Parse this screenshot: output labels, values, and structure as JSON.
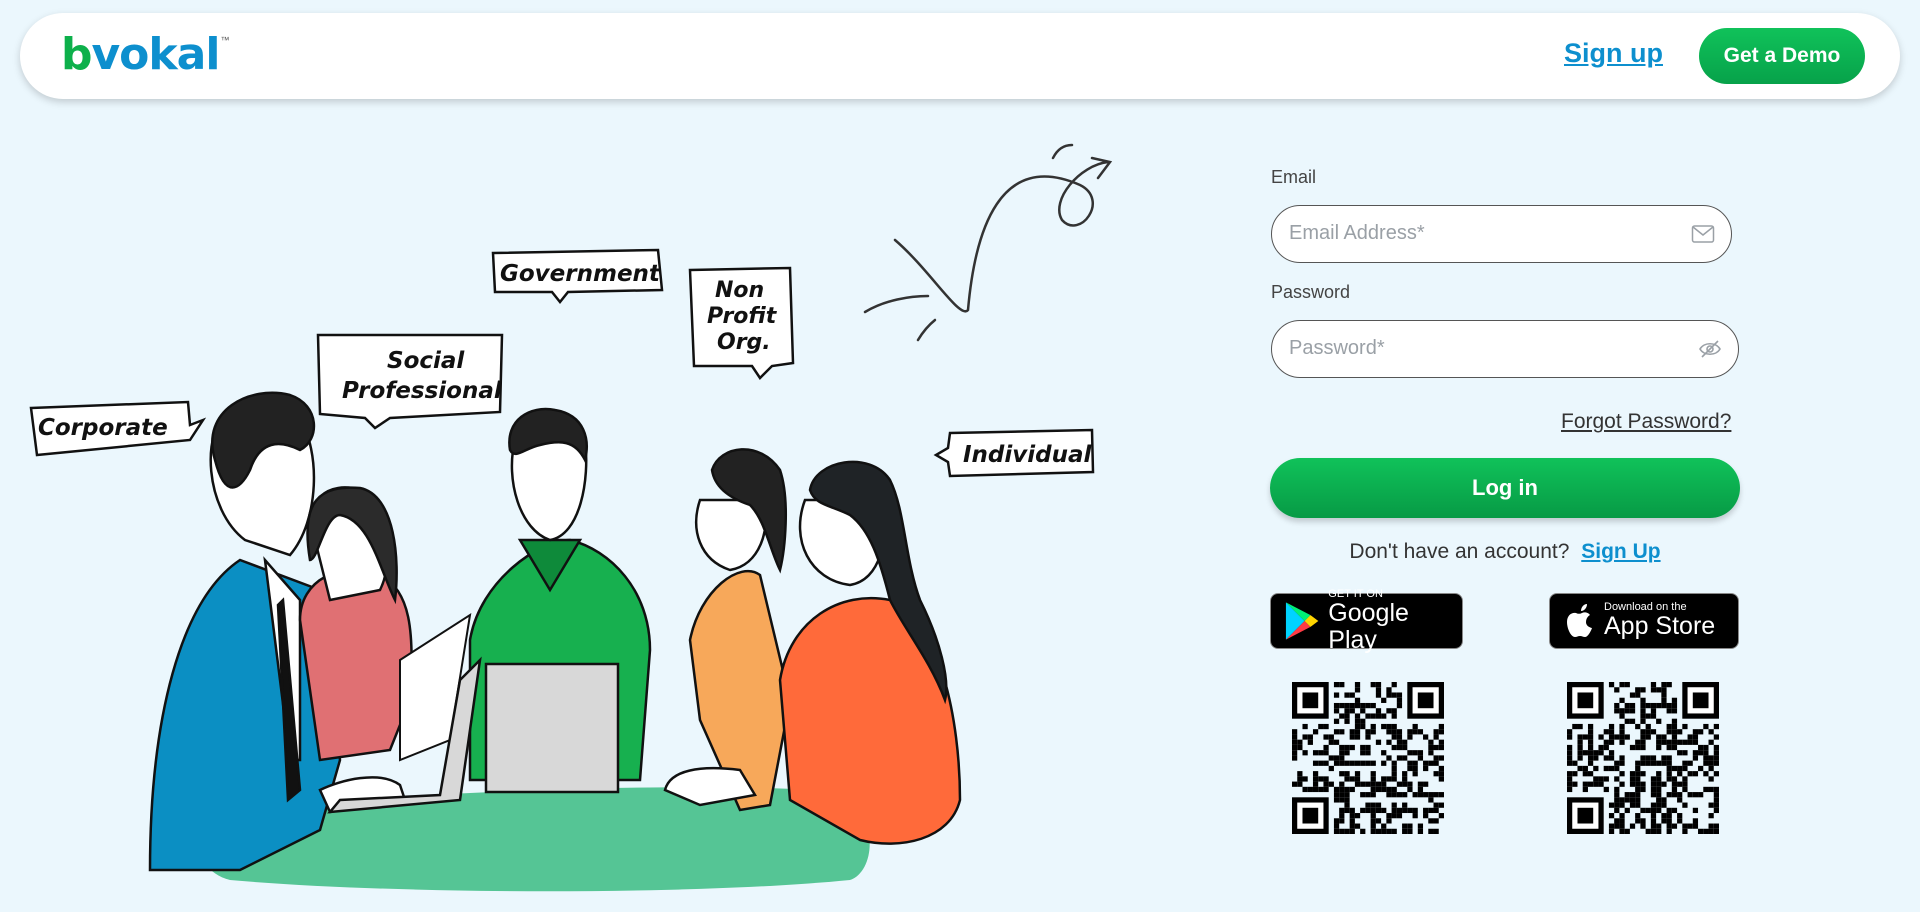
{
  "header": {
    "logo_b": "b",
    "logo_rest": "vokal",
    "logo_tm": "™",
    "signup_label": "Sign up",
    "demo_label": "Get a Demo"
  },
  "illustration": {
    "bubbles": {
      "corporate": "Corporate",
      "social_line1": "Social",
      "social_line2": "Professional",
      "government": "Government",
      "nonprofit_line1": "Non",
      "nonprofit_line2": "Profit",
      "nonprofit_line3": "Org.",
      "individual": "Individual"
    }
  },
  "form": {
    "email_label": "Email",
    "email_placeholder": "Email Address*",
    "email_icon": "envelope-icon",
    "password_label": "Password",
    "password_placeholder": "Password*",
    "password_icon": "eye-off-icon",
    "forgot_label": "Forgot Password?",
    "login_label": "Log in",
    "no_account_text": "Don't have an account?",
    "signup_link": "Sign Up"
  },
  "stores": {
    "google": {
      "small": "GET IT ON",
      "big": "Google Play"
    },
    "apple": {
      "small": "Download on the",
      "big": "App Store"
    }
  },
  "colors": {
    "brand_green": "#0db04b",
    "brand_blue": "#0d8fce",
    "background": "#ebf7fd"
  }
}
